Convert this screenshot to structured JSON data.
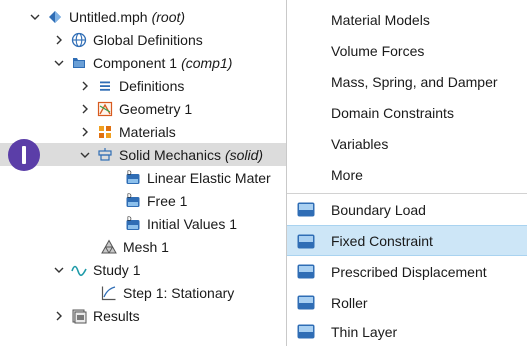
{
  "tree": {
    "rows": [
      {
        "label": "Untitled.mph",
        "tag": "(root)"
      },
      {
        "label": "Global Definitions",
        "tag": ""
      },
      {
        "label": "Component 1",
        "tag": "(comp1)"
      },
      {
        "label": "Definitions",
        "tag": ""
      },
      {
        "label": "Geometry 1",
        "tag": ""
      },
      {
        "label": "Materials",
        "tag": ""
      },
      {
        "label": "Solid Mechanics",
        "tag": "(solid)"
      },
      {
        "label": "Linear Elastic Mater",
        "tag": ""
      },
      {
        "label": "Free 1",
        "tag": ""
      },
      {
        "label": "Initial Values 1",
        "tag": ""
      },
      {
        "label": "Mesh 1",
        "tag": ""
      },
      {
        "label": "Study 1",
        "tag": ""
      },
      {
        "label": "Step 1: Stationary",
        "tag": ""
      },
      {
        "label": "Results",
        "tag": ""
      }
    ]
  },
  "menu": {
    "items": [
      {
        "label": "Material Models",
        "icon": "none"
      },
      {
        "label": "Volume Forces",
        "icon": "none"
      },
      {
        "label": "Mass, Spring, and Damper",
        "icon": "none"
      },
      {
        "label": "Domain Constraints",
        "icon": "none"
      },
      {
        "label": "Variables",
        "icon": "none"
      },
      {
        "label": "More",
        "icon": "none"
      },
      {
        "label": "Boundary Load",
        "icon": "boundary-load-icon"
      },
      {
        "label": "Fixed Constraint",
        "icon": "fixed-constraint-icon"
      },
      {
        "label": "Prescribed Displacement",
        "icon": "prescribed-displacement-icon"
      },
      {
        "label": "Roller",
        "icon": "roller-icon"
      },
      {
        "label": "Thin Layer",
        "icon": "thin-layer-icon"
      }
    ],
    "highlighted": "Fixed Constraint"
  },
  "colors": {
    "selection": "#dcdcdc",
    "menu_highlight": "#cde6f7",
    "marker": "#5b3ea8",
    "tree_icon_blue": "#2f6db5"
  }
}
